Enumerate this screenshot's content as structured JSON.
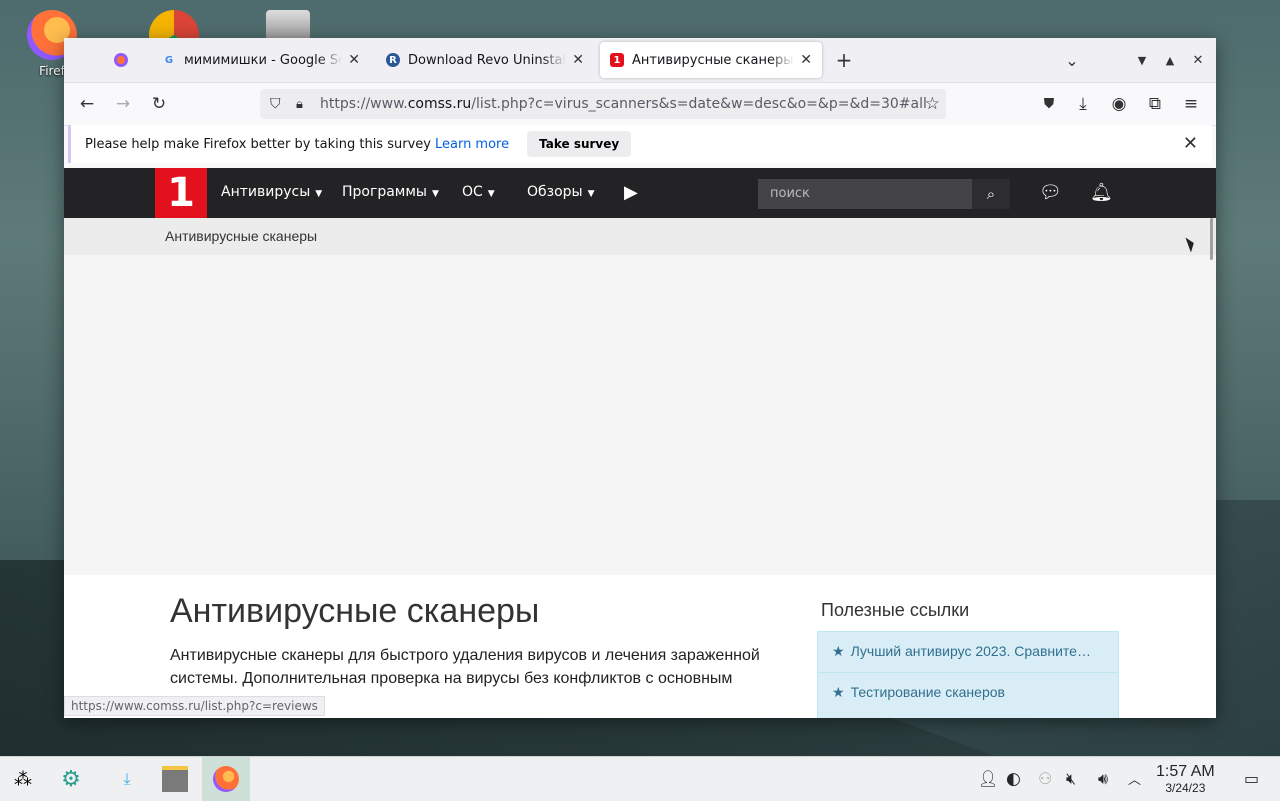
{
  "desktop": {
    "icons": [
      {
        "label": "Firef"
      }
    ]
  },
  "browser": {
    "tabs": [
      {
        "title": "",
        "favicon": "firefox-icon"
      },
      {
        "title": "мимимишки - Google Search",
        "favicon": "google-icon"
      },
      {
        "title": "Download Revo Uninstaller",
        "favicon": "revo-icon"
      },
      {
        "title": "Антивирусные сканеры - Comss.ru",
        "favicon": "comss-icon",
        "active": true
      }
    ],
    "new_tab": "+",
    "url_dim_prefix": "https://www.",
    "url_host": "comss.ru",
    "url_rest": "/list.php?c=virus_scanners&s=date&w=desc&o=&p=&d=30#all",
    "notification": {
      "text": "Please help make Firefox better by taking this survey",
      "learn_more": "Learn more",
      "button": "Take survey"
    },
    "status_url": "https://www.comss.ru/list.php?c=reviews"
  },
  "site": {
    "logo": "1",
    "menu": [
      "Антивирусы",
      "Программы",
      "ОС",
      "Обзоры"
    ],
    "search_placeholder": "поиск",
    "breadcrumb": "Антивирусные сканеры",
    "heading": "Антивирусные сканеры",
    "description": "Антивирусные сканеры для быстрого удаления вирусов и лечения зараженной системы. Дополнительная проверка на вирусы без конфликтов с основным антивирусом",
    "sidebar_title": "Полезные ссылки",
    "links": [
      "Лучший антивирус 2023. Сравните…",
      "Тестирование сканеров"
    ]
  },
  "taskbar": {
    "time": "1:57 AM",
    "date": "3/24/23"
  },
  "colors": {
    "site_red": "#e3101d",
    "site_nav": "#232325",
    "link_box": "#d9edf7",
    "link_text": "#31708f"
  }
}
